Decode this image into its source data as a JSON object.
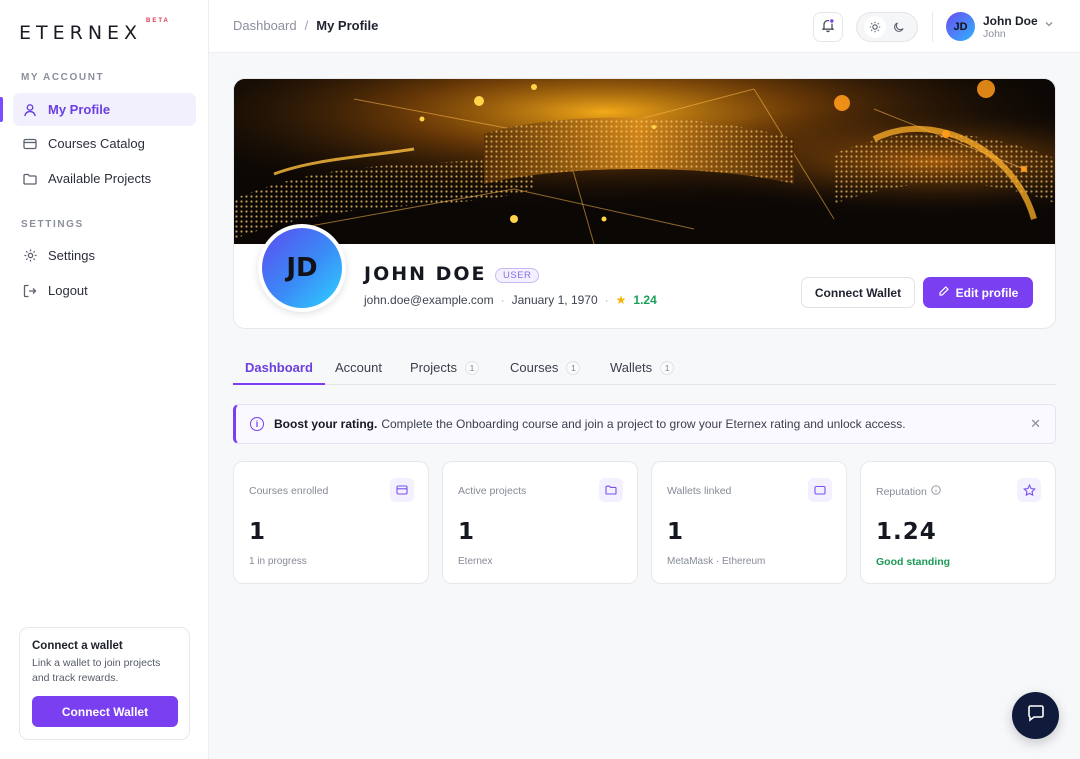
{
  "brand": {
    "name": "ETERNEX",
    "tag": "BETA"
  },
  "sidebar": {
    "sections": [
      {
        "title": "MY ACCOUNT",
        "items": [
          {
            "label": "My Profile",
            "icon": "user-icon",
            "active": true
          },
          {
            "label": "Courses Catalog",
            "icon": "catalog-icon",
            "active": false
          },
          {
            "label": "Available Projects",
            "icon": "folder-icon",
            "active": false
          }
        ]
      },
      {
        "title": "SETTINGS",
        "items": [
          {
            "label": "Settings",
            "icon": "gear-icon",
            "active": false
          },
          {
            "label": "Logout",
            "icon": "logout-icon",
            "active": false
          }
        ]
      }
    ],
    "wallet_card": {
      "title": "Connect a wallet",
      "text": "Link a wallet to join projects and track rewards.",
      "button": "Connect Wallet"
    }
  },
  "header": {
    "breadcrumb": {
      "parent": "Dashboard",
      "separator": "/",
      "current": "My Profile"
    },
    "user": {
      "initials": "JD",
      "name": "John Doe",
      "sub": "John"
    }
  },
  "profile": {
    "initials": "JD",
    "name": "JOHN DOE",
    "role": "USER",
    "email": "john.doe@example.com",
    "birthdate": "January 1, 1970",
    "rating": "1.24",
    "connect_wallet": "Connect Wallet",
    "edit_profile": "Edit profile"
  },
  "tabs": [
    {
      "label": "Dashboard",
      "count": null,
      "active": true
    },
    {
      "label": "Account",
      "count": null,
      "active": false
    },
    {
      "label": "Projects",
      "count": "1",
      "active": false
    },
    {
      "label": "Courses",
      "count": "1",
      "active": false
    },
    {
      "label": "Wallets",
      "count": "1",
      "active": false
    }
  ],
  "alert": {
    "title": "Boost your rating.",
    "text": "Complete the Onboarding course and join a project to grow your Eternex rating and unlock access."
  },
  "stats": [
    {
      "label": "Courses enrolled",
      "value": "1",
      "sub": "1 in progress",
      "icon": "card-icon"
    },
    {
      "label": "Active projects",
      "value": "1",
      "sub": "Eternex",
      "icon": "folder-icon"
    },
    {
      "label": "Wallets linked",
      "value": "1",
      "sub": "MetaMask · Ethereum",
      "icon": "wallet-icon"
    },
    {
      "label": "Reputation",
      "value": "1.24",
      "sub": "Good standing",
      "icon": "star-icon"
    }
  ],
  "colors": {
    "accent": "#7a3ff0",
    "good": "#1a9a56",
    "star": "#f5b400"
  }
}
